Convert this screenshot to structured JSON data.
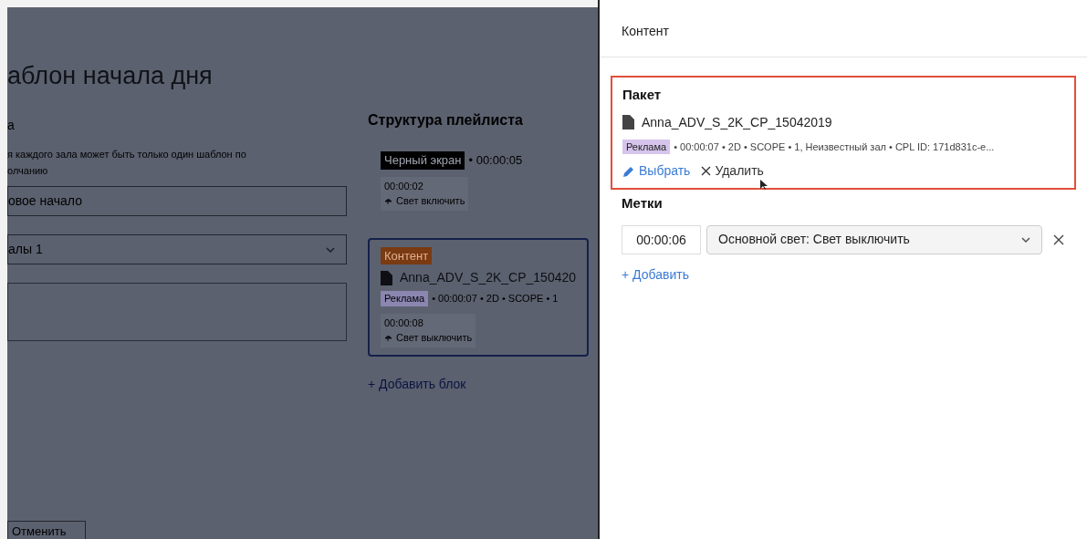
{
  "page": {
    "title": "аблон начала дня",
    "field_label": "а",
    "hint_lines": [
      "я каждого зала может быть только один шаблон по",
      "олчанию"
    ],
    "name_value": "овое начало",
    "hall_value": "алы 1",
    "cancel_button": "Отменить"
  },
  "playlist": {
    "title": "Структура плейлиста",
    "blocks": [
      {
        "kind": "black",
        "selected": false,
        "badge": "Черный экран",
        "duration": "• 00:00:05",
        "mark_time": "00:00:02",
        "mark_action": "Свет включить"
      },
      {
        "kind": "content",
        "selected": true,
        "badge": "Контент",
        "file": "Anna_ADV_S_2K_CP_150420",
        "tag": "Реклама",
        "meta": "• 00:00:07 • 2D • SCOPE • 1",
        "mark_time": "00:00:08",
        "mark_action": "Свет выключить"
      }
    ],
    "add_block": "+ Добавить блок"
  },
  "panel": {
    "subtitle": "Контент",
    "package": {
      "title": "Пакет",
      "file": "Anna_ADV_S_2K_CP_15042019",
      "tag": "Реклама",
      "meta": "• 00:00:07 • 2D • SCOPE • 1, Неизвестный зал • CPL ID: 171d831c-e...",
      "choose": "Выбрать",
      "remove": "Удалить"
    },
    "marks": {
      "title": "Метки",
      "items": [
        {
          "time": "00:00:06",
          "action": "Основной свет: Свет выключить"
        }
      ],
      "add": "+ Добавить"
    }
  }
}
